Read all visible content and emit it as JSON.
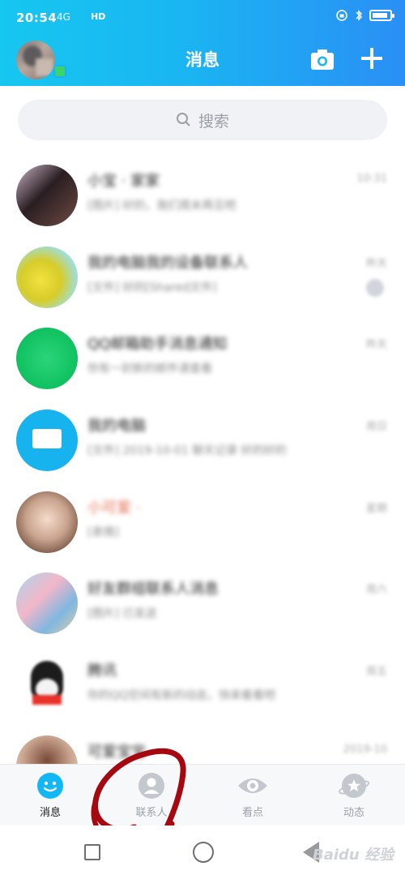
{
  "status_bar": {
    "time": "20:54",
    "signal": "4G",
    "hd": "HD"
  },
  "header": {
    "title": "消息"
  },
  "search": {
    "placeholder": "搜索"
  },
  "chats": [
    {
      "name": "小宝 · 家家",
      "preview": "[图片] 好的，我们周末再见吧",
      "time": "10:31"
    },
    {
      "name": "我的电脑我的设备联系人",
      "preview": "[文件] 好的[Shared文件]",
      "time": "昨天",
      "badge": "1"
    },
    {
      "name": "QQ邮箱助手消息通知",
      "preview": "你有一封新的邮件请查看",
      "time": "昨天"
    },
    {
      "name": "我的电脑",
      "preview": "[文件] 2019-10-01 聊天记录 好的好的",
      "time": "周日"
    },
    {
      "name": "小可爱 ·",
      "preview": "[表情]",
      "time": "星期"
    },
    {
      "name": "好友群组联系人消息",
      "preview": "[图片] 已发送",
      "time": "周六"
    },
    {
      "name": "腾讯",
      "preview": "你的QQ空间有新的动态，快来看看吧",
      "time": "周五"
    },
    {
      "name": "可爱宝宝",
      "preview": "",
      "time": "2019-10"
    }
  ],
  "tabs": [
    {
      "label": "消息",
      "icon": "message-icon",
      "active": true
    },
    {
      "label": "联系人",
      "icon": "contacts-icon",
      "active": false
    },
    {
      "label": "看点",
      "icon": "eye-icon",
      "active": false
    },
    {
      "label": "动态",
      "icon": "star-icon",
      "active": false
    }
  ],
  "watermark": "Baidu 经验",
  "colors": {
    "header_start": "#16c7f0",
    "header_end": "#2a8ff5",
    "accent": "#12b7f5",
    "annotation": "#a5080e"
  }
}
